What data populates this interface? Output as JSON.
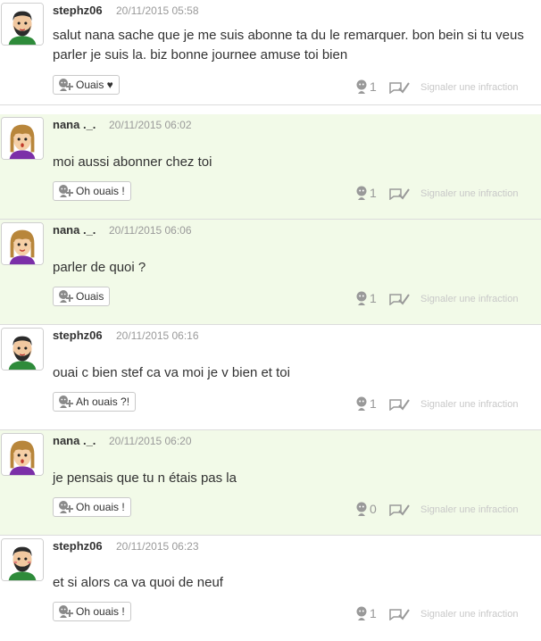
{
  "posts": [
    {
      "author": "stephz06",
      "timestamp": "20/11/2015 05:58",
      "text": "salut nana sache que je me suis abonne ta du le remarquer. bon bein si tu veus parler je suis la. biz bonne journee amuse toi bien",
      "reaction_label": "Ouais ♥",
      "count": "1",
      "report_label": "Signaler une infraction",
      "avatar": "male-avatar-icon",
      "alt": false
    },
    {
      "author": "nana ._.",
      "timestamp": "20/11/2015 06:02",
      "text": "moi aussi abonner chez toi",
      "reaction_label": "Oh ouais !",
      "count": "1",
      "report_label": "Signaler une infraction",
      "avatar": "female-avatar-icon",
      "alt": true
    },
    {
      "author": "nana ._.",
      "timestamp": "20/11/2015 06:06",
      "text": "parler de quoi ?",
      "reaction_label": "Ouais",
      "count": "1",
      "report_label": "Signaler une infraction",
      "avatar": "female-avatar-icon",
      "alt": true
    },
    {
      "author": "stephz06",
      "timestamp": "20/11/2015 06:16",
      "text": "ouai c bien stef ca va moi je v bien et toi",
      "reaction_label": "Ah ouais ?!",
      "count": "1",
      "report_label": "Signaler une infraction",
      "avatar": "male-avatar-icon",
      "alt": false
    },
    {
      "author": "nana ._.",
      "timestamp": "20/11/2015 06:20",
      "text": "je pensais que tu n étais pas la",
      "reaction_label": "Oh ouais !",
      "count": "0",
      "report_label": "Signaler une infraction",
      "avatar": "female-avatar-icon",
      "alt": true
    },
    {
      "author": "stephz06",
      "timestamp": "20/11/2015 06:23",
      "text": "et si alors ca va quoi de neuf",
      "reaction_label": "Oh ouais !",
      "count": "1",
      "report_label": "Signaler une infraction",
      "avatar": "male-avatar-icon",
      "alt": false
    }
  ],
  "colors": {
    "alt_background": "#f2fae8",
    "border": "#dcdcdc",
    "muted": "#9a9a9a",
    "report": "#c8c8c8"
  }
}
